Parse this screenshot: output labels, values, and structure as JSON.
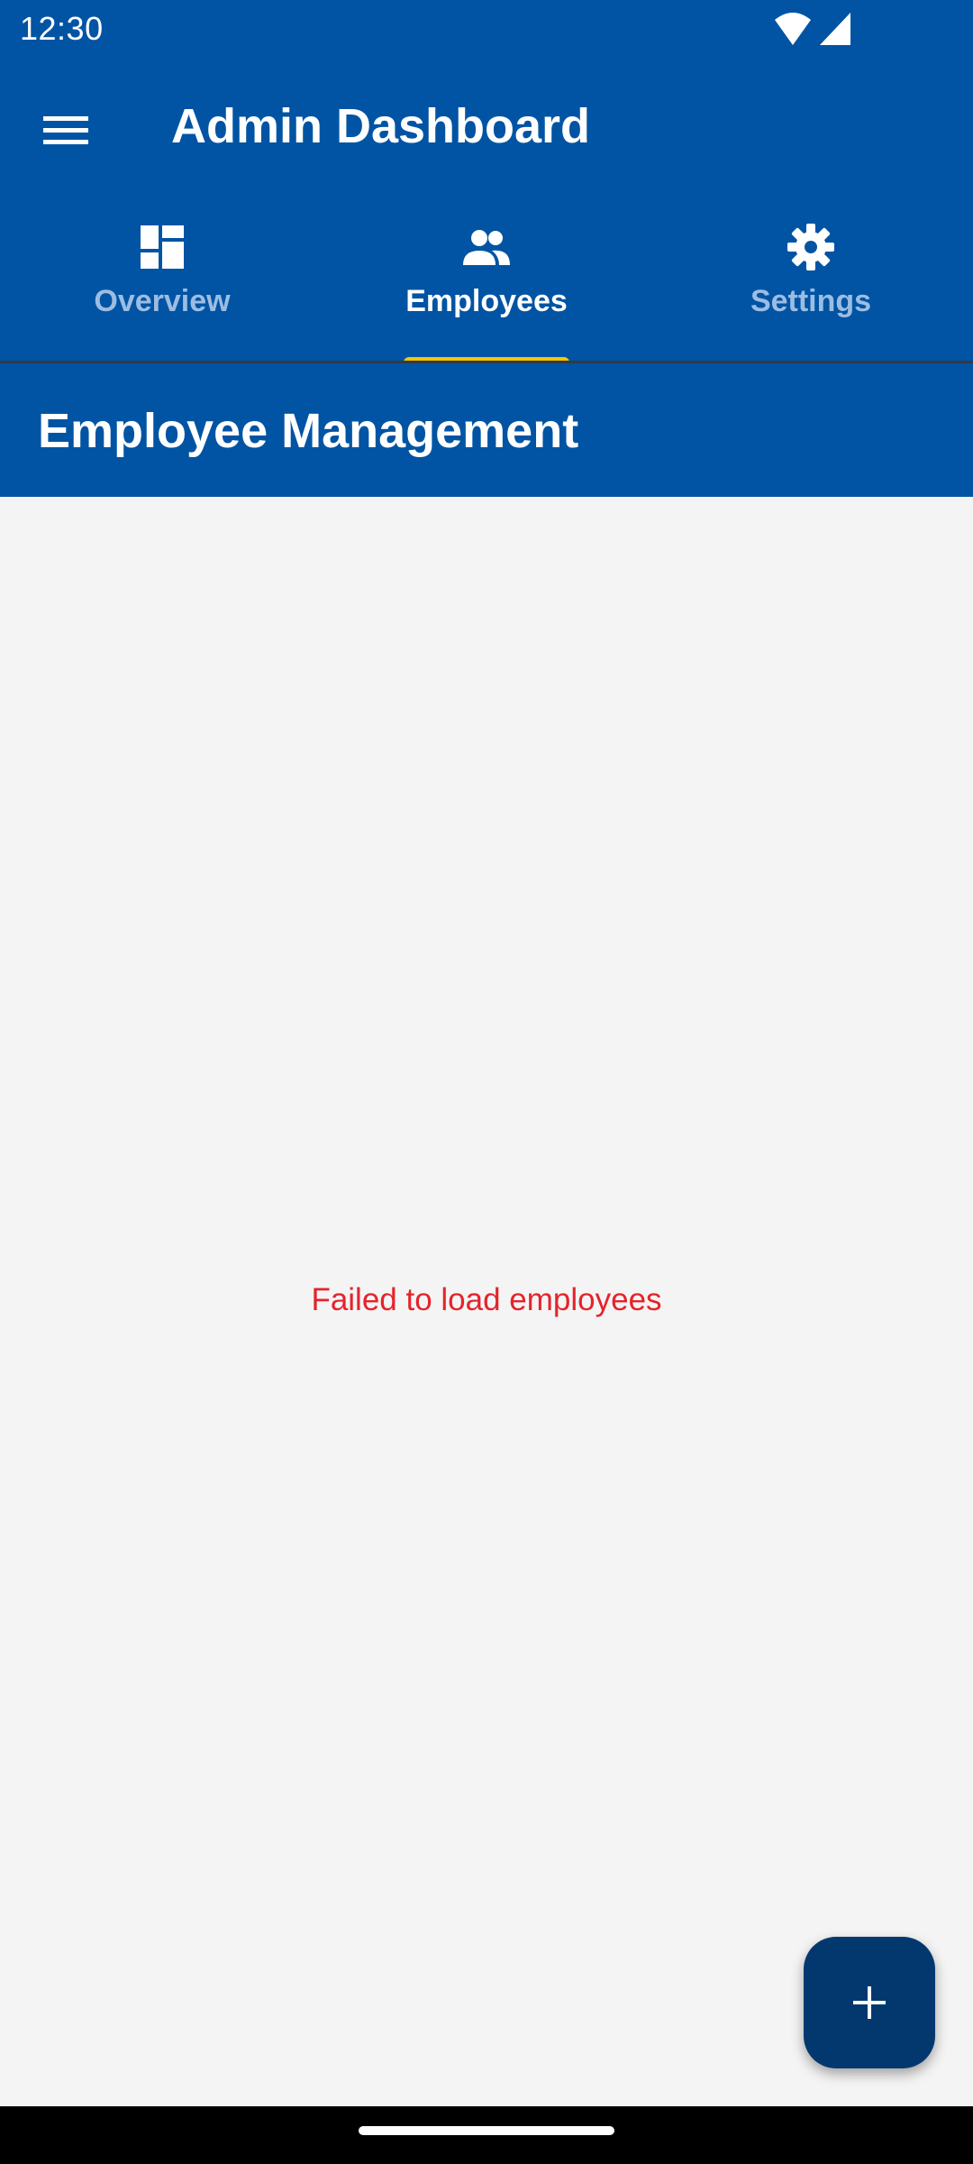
{
  "status_bar": {
    "time": "12:30",
    "icons": [
      "wifi-icon",
      "signal-icon"
    ]
  },
  "app_bar": {
    "menu_icon": "menu-icon",
    "title": "Admin Dashboard"
  },
  "tabs": [
    {
      "label": "Overview",
      "icon": "dashboard-icon",
      "active": false
    },
    {
      "label": "Employees",
      "icon": "people-icon",
      "active": true
    },
    {
      "label": "Settings",
      "icon": "gear-icon",
      "active": false
    }
  ],
  "section": {
    "title": "Employee Management"
  },
  "content": {
    "error_message": "Failed to load employees"
  },
  "fab": {
    "icon": "plus-icon"
  },
  "colors": {
    "primary": "#0054a3",
    "fab": "#03386f",
    "indicator": "#f5c400",
    "error": "#e5232b",
    "background": "#f4f4f4"
  }
}
